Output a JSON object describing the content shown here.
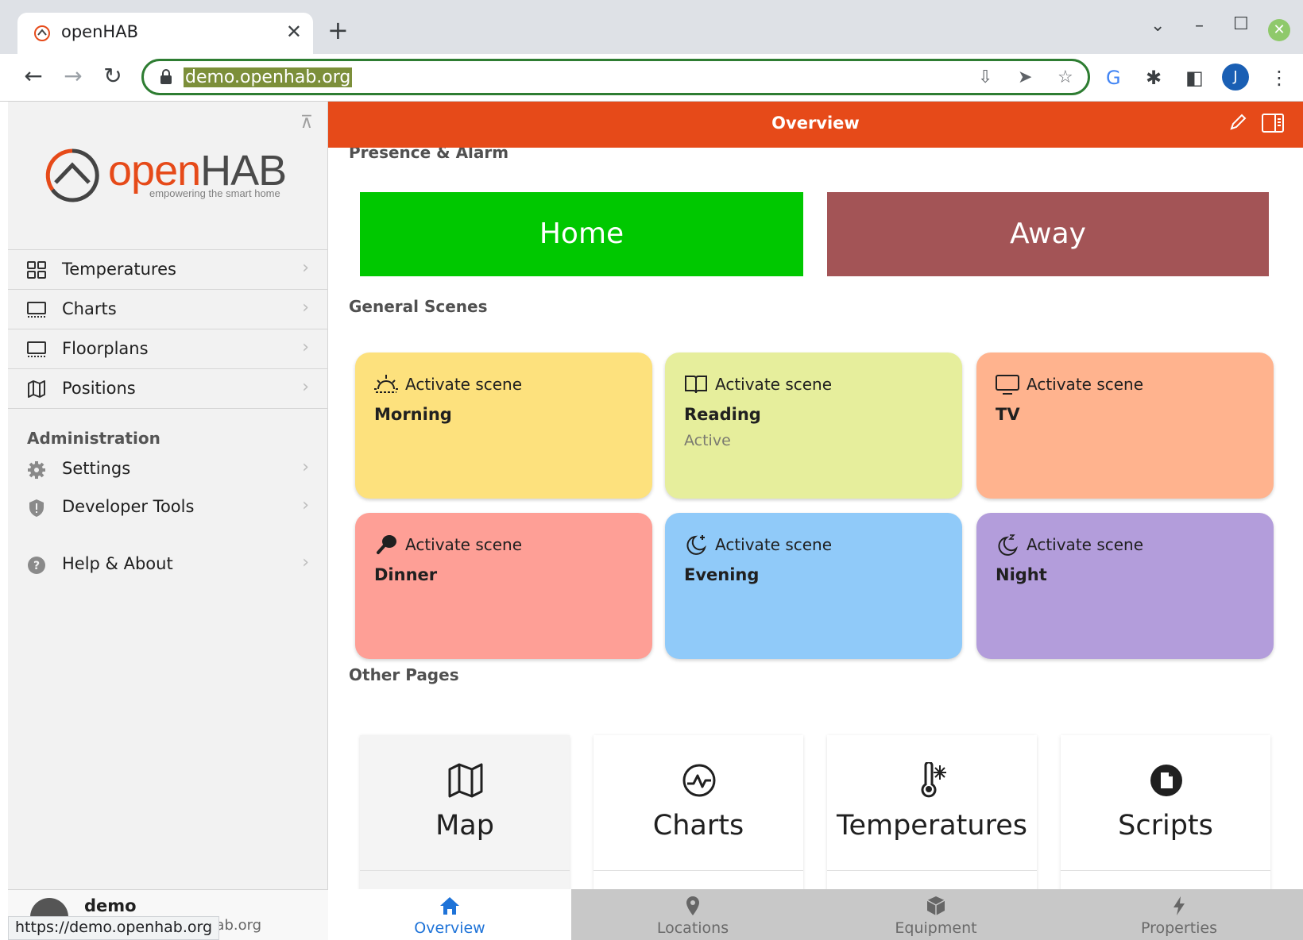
{
  "browser": {
    "tab_title": "openHAB",
    "new_tab": "+",
    "url": "demo.openhab.org",
    "status_url": "https://demo.openhab.org",
    "profile_initial": "J",
    "colors": {
      "omnibox_border": "#2e7d32",
      "profile": "#1a5fb4"
    }
  },
  "sidebar": {
    "logo": {
      "open": "open",
      "hab": "HAB",
      "tagline": "empowering the smart home"
    },
    "items": [
      {
        "label": "Temperatures",
        "icon": "grid-icon"
      },
      {
        "label": "Charts",
        "icon": "monitor-icon"
      },
      {
        "label": "Floorplans",
        "icon": "monitor-icon"
      },
      {
        "label": "Positions",
        "icon": "map-icon"
      }
    ],
    "admin_title": "Administration",
    "admin_items": [
      {
        "label": "Settings",
        "icon": "gear-icon"
      },
      {
        "label": "Developer Tools",
        "icon": "shield-icon"
      },
      {
        "label": "Help & About",
        "icon": "question-icon"
      }
    ],
    "user": {
      "name": "demo",
      "sub": "hab.org"
    }
  },
  "header": {
    "title": "Overview",
    "color": "#e64a19"
  },
  "presence": {
    "title": "Presence & Alarm",
    "home_label": "Home",
    "away_label": "Away",
    "home_color": "#00c800",
    "away_color": "#a35456"
  },
  "scenes": {
    "title": "General Scenes",
    "items": [
      {
        "action": "Activate scene",
        "name": "Morning",
        "status": "",
        "icon": "sunrise-icon",
        "color": "#fde17d"
      },
      {
        "action": "Activate scene",
        "name": "Reading",
        "status": "Active",
        "icon": "book-icon",
        "color": "#e6ee9c"
      },
      {
        "action": "Activate scene",
        "name": "TV",
        "status": "",
        "icon": "tv-icon",
        "color": "#ffb38e"
      },
      {
        "action": "Activate scene",
        "name": "Dinner",
        "status": "",
        "icon": "food-icon",
        "color": "#fe9f96"
      },
      {
        "action": "Activate scene",
        "name": "Evening",
        "status": "",
        "icon": "moon-stars-icon",
        "color": "#90caf9"
      },
      {
        "action": "Activate scene",
        "name": "Night",
        "status": "",
        "icon": "moon-sleep-icon",
        "color": "#b39ddb"
      }
    ]
  },
  "other_pages": {
    "title": "Other Pages",
    "items": [
      {
        "label": "Map",
        "icon": "map-icon"
      },
      {
        "label": "Charts",
        "icon": "chart-icon"
      },
      {
        "label": "Temperatures",
        "icon": "thermometer-icon"
      },
      {
        "label": "Scripts",
        "icon": "scripts-icon"
      }
    ]
  },
  "tabbar": {
    "items": [
      {
        "label": "Overview",
        "icon": "home-icon",
        "active": true
      },
      {
        "label": "Locations",
        "icon": "location-pin-icon",
        "active": false
      },
      {
        "label": "Equipment",
        "icon": "box-icon",
        "active": false
      },
      {
        "label": "Properties",
        "icon": "bolt-icon",
        "active": false
      }
    ],
    "active_color": "#1e73d8"
  }
}
